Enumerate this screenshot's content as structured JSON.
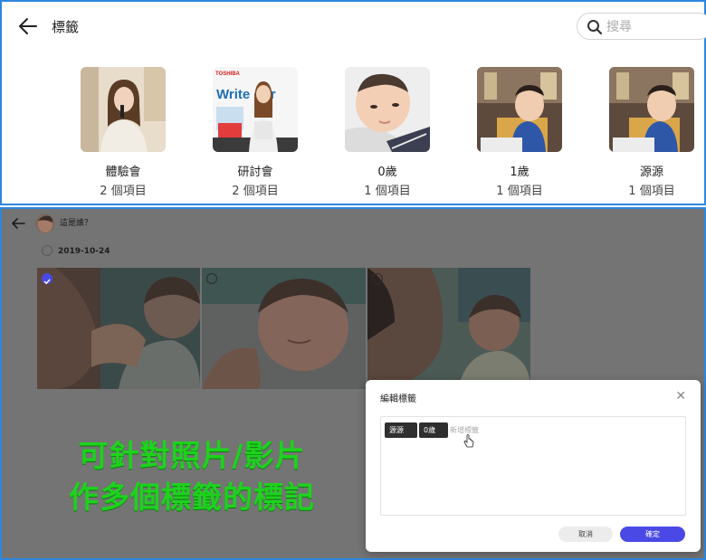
{
  "header": {
    "title": "標籤",
    "search_placeholder": "搜尋"
  },
  "tags": [
    {
      "name": "體驗會",
      "count": "2 個項目"
    },
    {
      "name": "研討會",
      "count": "2 個項目"
    },
    {
      "name": "0歲",
      "count": "1 個項目"
    },
    {
      "name": "1歲",
      "count": "1 個項目"
    },
    {
      "name": "源源",
      "count": "1 個項目"
    }
  ],
  "thumb_print": {
    "brand": "TOSHIBA",
    "sign": "Write our"
  },
  "album": {
    "title": "這是誰？",
    "date": "2019-10-24"
  },
  "caption": {
    "line1": "可針對照片/影片",
    "line2": "作多個標籤的標記"
  },
  "dialog": {
    "title": "編輯標籤",
    "tags": [
      "源源",
      "0歲"
    ],
    "input_placeholder": "新增標籤",
    "cancel_label": "取消",
    "confirm_label": "確定"
  },
  "colors": {
    "accent": "#4a49e6",
    "frame_border": "#2e86de",
    "caption_green": "#1ed21e"
  }
}
